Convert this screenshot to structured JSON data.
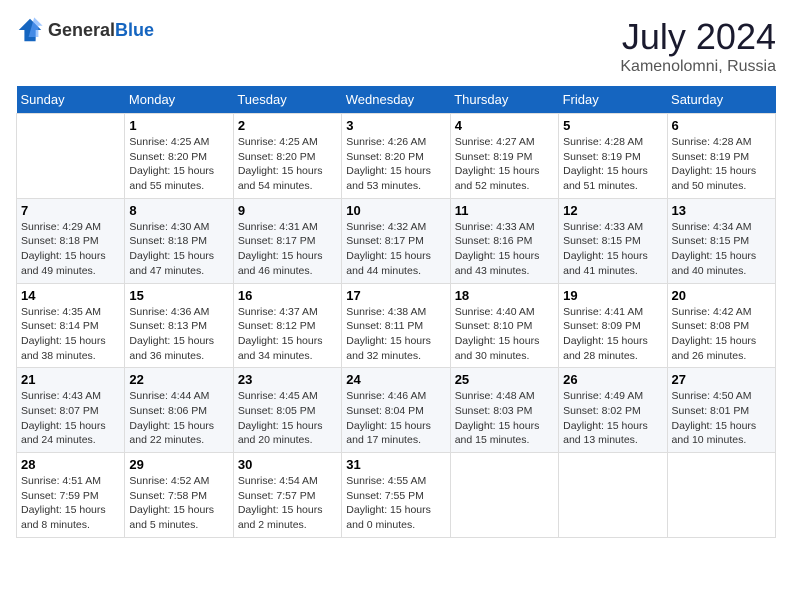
{
  "header": {
    "logo_general": "General",
    "logo_blue": "Blue",
    "month": "July 2024",
    "location": "Kamenolomni, Russia"
  },
  "weekdays": [
    "Sunday",
    "Monday",
    "Tuesday",
    "Wednesday",
    "Thursday",
    "Friday",
    "Saturday"
  ],
  "weeks": [
    [
      {
        "day": "",
        "info": ""
      },
      {
        "day": "1",
        "info": "Sunrise: 4:25 AM\nSunset: 8:20 PM\nDaylight: 15 hours\nand 55 minutes."
      },
      {
        "day": "2",
        "info": "Sunrise: 4:25 AM\nSunset: 8:20 PM\nDaylight: 15 hours\nand 54 minutes."
      },
      {
        "day": "3",
        "info": "Sunrise: 4:26 AM\nSunset: 8:20 PM\nDaylight: 15 hours\nand 53 minutes."
      },
      {
        "day": "4",
        "info": "Sunrise: 4:27 AM\nSunset: 8:19 PM\nDaylight: 15 hours\nand 52 minutes."
      },
      {
        "day": "5",
        "info": "Sunrise: 4:28 AM\nSunset: 8:19 PM\nDaylight: 15 hours\nand 51 minutes."
      },
      {
        "day": "6",
        "info": "Sunrise: 4:28 AM\nSunset: 8:19 PM\nDaylight: 15 hours\nand 50 minutes."
      }
    ],
    [
      {
        "day": "7",
        "info": "Sunrise: 4:29 AM\nSunset: 8:18 PM\nDaylight: 15 hours\nand 49 minutes."
      },
      {
        "day": "8",
        "info": "Sunrise: 4:30 AM\nSunset: 8:18 PM\nDaylight: 15 hours\nand 47 minutes."
      },
      {
        "day": "9",
        "info": "Sunrise: 4:31 AM\nSunset: 8:17 PM\nDaylight: 15 hours\nand 46 minutes."
      },
      {
        "day": "10",
        "info": "Sunrise: 4:32 AM\nSunset: 8:17 PM\nDaylight: 15 hours\nand 44 minutes."
      },
      {
        "day": "11",
        "info": "Sunrise: 4:33 AM\nSunset: 8:16 PM\nDaylight: 15 hours\nand 43 minutes."
      },
      {
        "day": "12",
        "info": "Sunrise: 4:33 AM\nSunset: 8:15 PM\nDaylight: 15 hours\nand 41 minutes."
      },
      {
        "day": "13",
        "info": "Sunrise: 4:34 AM\nSunset: 8:15 PM\nDaylight: 15 hours\nand 40 minutes."
      }
    ],
    [
      {
        "day": "14",
        "info": "Sunrise: 4:35 AM\nSunset: 8:14 PM\nDaylight: 15 hours\nand 38 minutes."
      },
      {
        "day": "15",
        "info": "Sunrise: 4:36 AM\nSunset: 8:13 PM\nDaylight: 15 hours\nand 36 minutes."
      },
      {
        "day": "16",
        "info": "Sunrise: 4:37 AM\nSunset: 8:12 PM\nDaylight: 15 hours\nand 34 minutes."
      },
      {
        "day": "17",
        "info": "Sunrise: 4:38 AM\nSunset: 8:11 PM\nDaylight: 15 hours\nand 32 minutes."
      },
      {
        "day": "18",
        "info": "Sunrise: 4:40 AM\nSunset: 8:10 PM\nDaylight: 15 hours\nand 30 minutes."
      },
      {
        "day": "19",
        "info": "Sunrise: 4:41 AM\nSunset: 8:09 PM\nDaylight: 15 hours\nand 28 minutes."
      },
      {
        "day": "20",
        "info": "Sunrise: 4:42 AM\nSunset: 8:08 PM\nDaylight: 15 hours\nand 26 minutes."
      }
    ],
    [
      {
        "day": "21",
        "info": "Sunrise: 4:43 AM\nSunset: 8:07 PM\nDaylight: 15 hours\nand 24 minutes."
      },
      {
        "day": "22",
        "info": "Sunrise: 4:44 AM\nSunset: 8:06 PM\nDaylight: 15 hours\nand 22 minutes."
      },
      {
        "day": "23",
        "info": "Sunrise: 4:45 AM\nSunset: 8:05 PM\nDaylight: 15 hours\nand 20 minutes."
      },
      {
        "day": "24",
        "info": "Sunrise: 4:46 AM\nSunset: 8:04 PM\nDaylight: 15 hours\nand 17 minutes."
      },
      {
        "day": "25",
        "info": "Sunrise: 4:48 AM\nSunset: 8:03 PM\nDaylight: 15 hours\nand 15 minutes."
      },
      {
        "day": "26",
        "info": "Sunrise: 4:49 AM\nSunset: 8:02 PM\nDaylight: 15 hours\nand 13 minutes."
      },
      {
        "day": "27",
        "info": "Sunrise: 4:50 AM\nSunset: 8:01 PM\nDaylight: 15 hours\nand 10 minutes."
      }
    ],
    [
      {
        "day": "28",
        "info": "Sunrise: 4:51 AM\nSunset: 7:59 PM\nDaylight: 15 hours\nand 8 minutes."
      },
      {
        "day": "29",
        "info": "Sunrise: 4:52 AM\nSunset: 7:58 PM\nDaylight: 15 hours\nand 5 minutes."
      },
      {
        "day": "30",
        "info": "Sunrise: 4:54 AM\nSunset: 7:57 PM\nDaylight: 15 hours\nand 2 minutes."
      },
      {
        "day": "31",
        "info": "Sunrise: 4:55 AM\nSunset: 7:55 PM\nDaylight: 15 hours\nand 0 minutes."
      },
      {
        "day": "",
        "info": ""
      },
      {
        "day": "",
        "info": ""
      },
      {
        "day": "",
        "info": ""
      }
    ]
  ]
}
